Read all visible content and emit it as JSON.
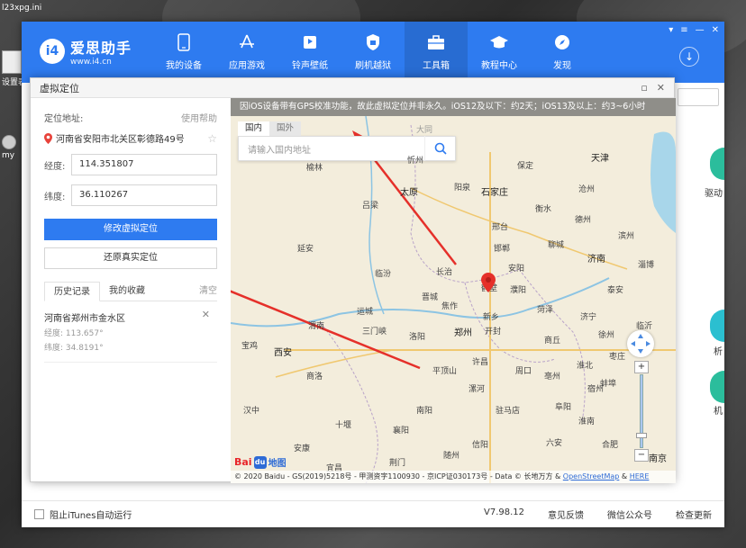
{
  "desktop": {
    "icons": [
      {
        "label": "l23xpg.ini"
      },
      {
        "label": "设置表"
      },
      {
        "label": "my"
      }
    ]
  },
  "app": {
    "logo": {
      "name": "爱思助手",
      "url": "www.i4.cn",
      "badge": "i4"
    },
    "nav": [
      {
        "label": "我的设备",
        "icon": "phone-icon"
      },
      {
        "label": "应用游戏",
        "icon": "app-store-icon"
      },
      {
        "label": "铃声壁纸",
        "icon": "ringtone-icon"
      },
      {
        "label": "刷机越狱",
        "icon": "shield-icon"
      },
      {
        "label": "工具箱",
        "icon": "toolbox-icon",
        "active": true
      },
      {
        "label": "教程中心",
        "icon": "graduation-cap-icon"
      },
      {
        "label": "发现",
        "icon": "compass-icon"
      }
    ],
    "right_strip": {
      "label_1": "驱动",
      "label_2": "析",
      "label_3": "机"
    },
    "footer": {
      "itunes_checkbox_label": "阻止iTunes自动运行",
      "version": "V7.98.12",
      "feedback": "意见反馈",
      "wechat": "微信公众号",
      "update": "检查更新"
    }
  },
  "dialog": {
    "title": "虚拟定位",
    "panel": {
      "location_label": "定位地址:",
      "help": "使用帮助",
      "address": "河南省安阳市北关区彰德路49号",
      "longitude_label": "经度:",
      "longitude_value": "114.351807",
      "latitude_label": "纬度:",
      "latitude_value": "36.110267",
      "modify_button": "修改虚拟定位",
      "restore_button": "还原真实定位",
      "tabs": {
        "history": "历史记录",
        "favorites": "我的收藏",
        "clear": "清空"
      },
      "history": [
        {
          "name": "河南省郑州市金水区",
          "lng": "经度: 113.657°",
          "lat": "纬度: 34.8191°"
        }
      ]
    },
    "map": {
      "banner": "因iOS设备带有GPS校准功能，故此虚拟定位并非永久。iOS12及以下：约2天；iOS13及以上：约3~6小时",
      "tab_domestic": "国内",
      "tab_foreign": "国外",
      "search_placeholder": "请输入国内地址",
      "copyright": "© 2020 Baidu - GS(2019)5218号 - 甲测资字1100930 - 京ICP证030173号 - Data © 长地万方 &",
      "copyright_link1": "OpenStreetMap",
      "copyright_link2": "HERE",
      "baidu_text": "Bai",
      "baidu_paw": "du",
      "baidu_suffix": "地图",
      "cities": {
        "beijing_area": "天津",
        "taiyuan": "太原",
        "shijiazhuang": "石家庄",
        "jinan": "济南",
        "zhengzhou": "郑州",
        "xian": "西安",
        "hebi": "鹤壁",
        "nanjing": "南京",
        "yulin": "榆林",
        "lvliang": "吕梁",
        "yangquan": "阳泉",
        "xingtai": "邢台",
        "handan": "邯郸",
        "liaocheng": "聊城",
        "changzhi": "长治",
        "linfen": "临汾",
        "yanan": "延安",
        "xinxiang": "新乡",
        "puyang": "濮阳",
        "heze": "菏泽",
        "luoyang": "洛阳",
        "kaifeng": "开封",
        "shangqiu": "商丘",
        "xuzhou": "徐州",
        "pingdingshan": "平顶山",
        "zhoukou": "周口",
        "zhumadian": "驻马店",
        "nanyang": "南阳",
        "fuyang": "阜阳",
        "bengbu": "蚌埠",
        "hefei": "合肥",
        "xiangyang": "襄阳",
        "xinyang": "信阳",
        "sanmenxia": "三门峡",
        "weinan": "渭南",
        "baoji": "宝鸡",
        "shangluo": "商洛",
        "dezhou": "德州",
        "cangzhou": "沧州",
        "taian": "泰安",
        "linyi": "临沂",
        "hanzhong": "汉中",
        "ankang": "安康",
        "shiyan": "十堰",
        "jiaozuo": "焦作",
        "xuchang": "许昌",
        "luohe": "漯河",
        "anyang": "安阳",
        "datong": "大同",
        "xinzhou": "忻州",
        "jincheng": "晋城",
        "yuncheng": "运城",
        "baoding": "保定",
        "hengshui": "衡水",
        "binzhou": "滨州",
        "zibo": "淄博",
        "jining": "济宁",
        "zaozhuang": "枣庄",
        "bozhou": "亳州",
        "huaibei": "淮北",
        "suzhou_ah": "宿州",
        "huainan": "淮南",
        "liuan": "六安",
        "suizhou": "随州",
        "jingmen": "荆门",
        "yichang": "宜昌"
      }
    }
  }
}
